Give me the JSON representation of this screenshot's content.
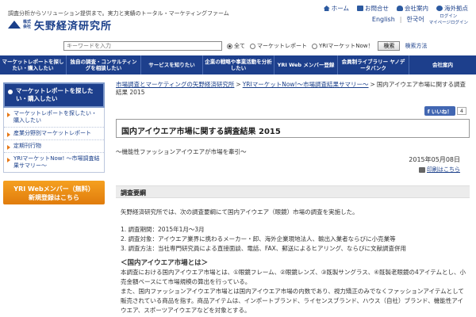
{
  "header": {
    "tagline": "調査分析からソリューション提供まで。実力と実績のトータル・マーケティングファーム",
    "logo_kabu": "株式会社",
    "logo_name": "矢野経済研究所",
    "toplinks": [
      "ホーム",
      "お問合せ",
      "会社案内",
      "海外拠点"
    ],
    "langs": [
      "English",
      "한국어"
    ],
    "mypage_top": "ログイン",
    "mypage": "マイページログイン"
  },
  "search": {
    "placeholder": "キーワードを入力",
    "options": [
      "全て",
      "マーケットレポート",
      "YRIマーケットNow！"
    ],
    "selected_index": 0,
    "button": "検索",
    "method": "検索方法"
  },
  "nav": [
    "マーケットレポートを探したい・購入したい",
    "独自の調査・コンサルティングを相談したい",
    "サービスを知りたい",
    "企業の戦略や事業活動を分析したい",
    "YRI Web メンバー登録",
    "会員制ライブラリー ヤノデータバンク",
    "会社案内"
  ],
  "sidebar": {
    "head": "マーケットレポートを探したい・購入したい",
    "items": [
      "マーケットレポートを探したい・購入したい",
      "産業分野別マーケットレポート",
      "定期刊行物",
      "YRIマーケットNow! 〜市場調査結果サマリー〜"
    ],
    "member_line1": "YRI Webメンバー（無料）",
    "member_line2": "新規登録はこちら"
  },
  "breadcrumb": {
    "link1": "市場調査とマーケティングの矢野経済研究所",
    "link2": "YRIマーケットNow!〜市場調査結果サマリー〜",
    "current": "国内アイウエア市場に関する調査結果 2015"
  },
  "facebook": {
    "label": "いいね！",
    "count": "4"
  },
  "article": {
    "title": "国内アイウエア市場に関する調査結果 2015",
    "subtitle": "〜機能性ファッションアイウエアが市場を牽引〜",
    "date": "2015年05月08日",
    "print": "印刷はこちら",
    "section": "調査要綱",
    "intro": "矢野経済研究所では、次の調査要綱にて国内アイウエア（眼鏡）市場の調査を実施した。",
    "points": [
      "1. 調査期間：2015年1月〜3月",
      "2. 調査対象：アイウエア業界に携わるメーカー・卸、海外企業現地法人、輸出入業者ならびに小売業等",
      "3. 調査方法：当社専門研究員による直接面談、電話、FAX、郵送によるヒアリング、ならびに文献調査併用"
    ],
    "heading": "＜国内アイウエア市場とは＞",
    "body1": "本調査における国内アイウエア市場とは、①眼鏡フレーム、②眼鏡レンズ、③既製サングラス、④既製老眼鏡の4アイテムとし、小売金額ベースにて市場規模の算出を行っている。",
    "body2": "また、国内ファッションアイウエア市場とは国内アイウエア市場の内数であり、視力矯正のみでなくファッションアイテムとして販売されている商品を指す。商品アイテムは、インポートブランド、ライセンスブランド、ハウス（自社）ブランド、機能性アイウエア、スポーツアイウエアなどを対象とする。"
  },
  "colors": {
    "nav_bg": "#1d3f8c",
    "accent_orange": "#e67817",
    "link": "#1a3f8a"
  }
}
